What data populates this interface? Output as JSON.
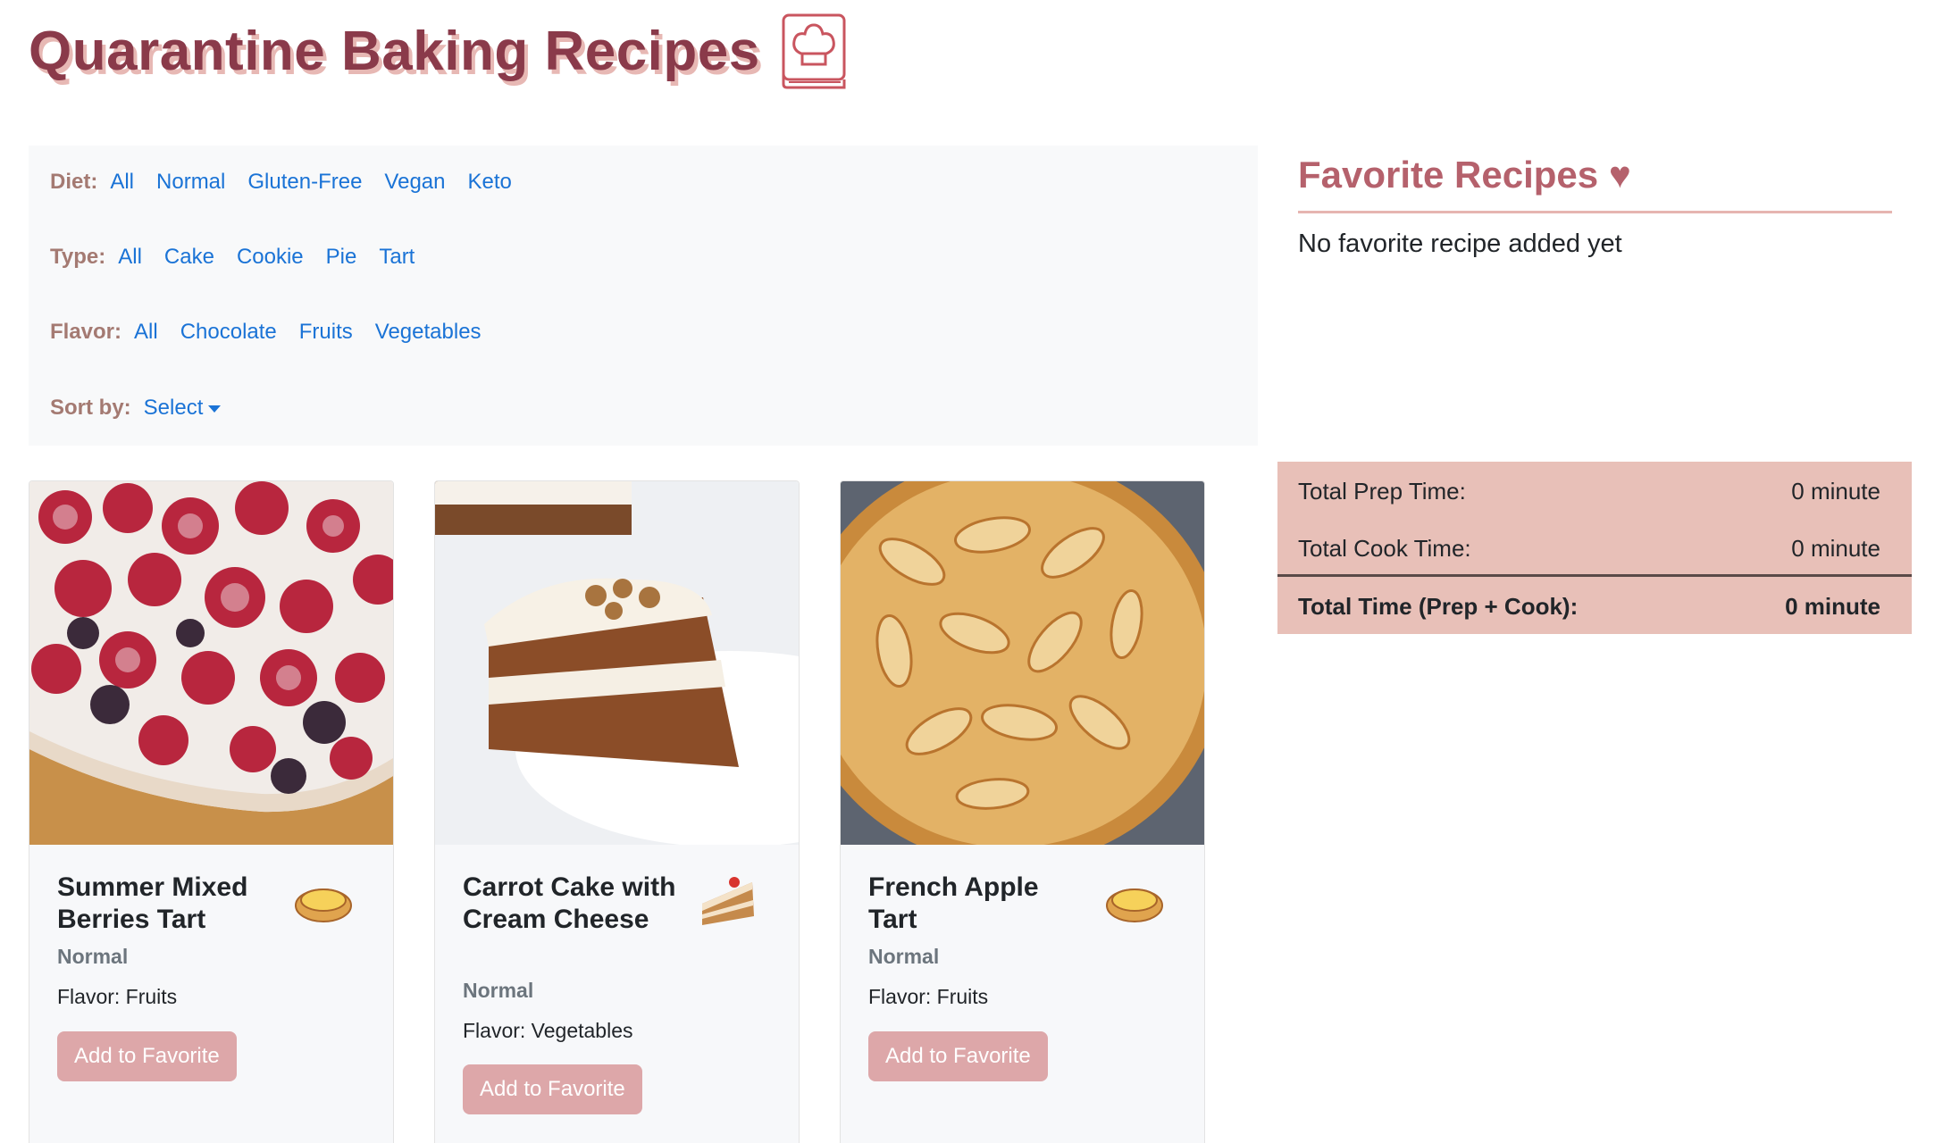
{
  "header": {
    "title": "Quarantine Baking Recipes",
    "icon": "chef-hat-book-icon"
  },
  "filters": {
    "diet": {
      "label": "Diet:",
      "options": [
        "All",
        "Normal",
        "Gluten-Free",
        "Vegan",
        "Keto"
      ]
    },
    "type": {
      "label": "Type:",
      "options": [
        "All",
        "Cake",
        "Cookie",
        "Pie",
        "Tart"
      ]
    },
    "flavor": {
      "label": "Flavor:",
      "options": [
        "All",
        "Chocolate",
        "Fruits",
        "Vegetables"
      ]
    },
    "sort": {
      "label": "Sort by:",
      "selected": "Select"
    }
  },
  "recipes": [
    {
      "name": "Summer Mixed Berries Tart",
      "diet": "Normal",
      "flavor": "Flavor: Fruits",
      "button": "Add to Favorite",
      "type_icon": "tart-icon",
      "image": "berry-tart-photo"
    },
    {
      "name": "Carrot Cake with Cream Cheese",
      "diet": "Normal",
      "flavor": "Flavor: Vegetables",
      "button": "Add to Favorite",
      "type_icon": "cake-slice-icon",
      "image": "carrot-cake-photo"
    },
    {
      "name": "French Apple Tart",
      "diet": "Normal",
      "flavor": "Flavor: Fruits",
      "button": "Add to Favorite",
      "type_icon": "tart-icon",
      "image": "apple-tart-photo"
    }
  ],
  "favorites": {
    "title": "Favorite Recipes ♥",
    "empty_message": "No favorite recipe added yet"
  },
  "totals": {
    "prep_label": "Total Prep Time:",
    "prep_value": "0 minute",
    "cook_label": "Total Cook Time:",
    "cook_value": "0 minute",
    "total_label": "Total Time (Prep + Cook):",
    "total_value": "0 minute"
  },
  "colors": {
    "title": "#8a3a4a",
    "link": "#1a73d6",
    "button": "#dda7a9",
    "totals_bg": "#e8c0b8",
    "favorites_title": "#b5616c"
  }
}
